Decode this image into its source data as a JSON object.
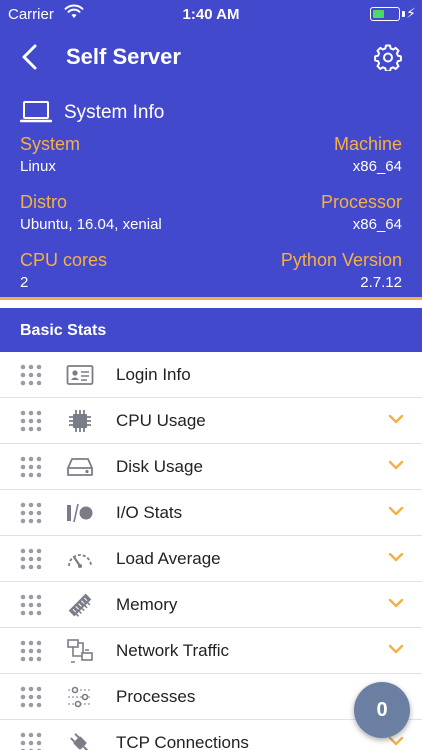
{
  "status_bar": {
    "carrier": "Carrier",
    "time": "1:40 AM",
    "battery_level": 0.45
  },
  "nav": {
    "title": "Self Server",
    "back_icon": "chevron-left-icon",
    "settings_icon": "gear-icon"
  },
  "system_info": {
    "title": "System Info",
    "icon": "laptop-icon",
    "rows": [
      {
        "left_label": "System",
        "left_value": "Linux",
        "right_label": "Machine",
        "right_value": "x86_64"
      },
      {
        "left_label": "Distro",
        "left_value": "Ubuntu, 16.04, xenial",
        "right_label": "Processor",
        "right_value": "x86_64"
      },
      {
        "left_label": "CPU cores",
        "left_value": "2",
        "right_label": "Python Version",
        "right_value": "2.7.12"
      }
    ]
  },
  "basic_stats": {
    "title": "Basic Stats",
    "items": [
      {
        "label": "Login Info",
        "icon": "id-card-icon",
        "expandable": false
      },
      {
        "label": "CPU Usage",
        "icon": "cpu-chip-icon",
        "expandable": true
      },
      {
        "label": "Disk Usage",
        "icon": "hard-drive-icon",
        "expandable": true
      },
      {
        "label": "I/O Stats",
        "icon": "io-icon",
        "expandable": true
      },
      {
        "label": "Load Average",
        "icon": "speedometer-icon",
        "expandable": true
      },
      {
        "label": "Memory",
        "icon": "memory-stick-icon",
        "expandable": true
      },
      {
        "label": "Network Traffic",
        "icon": "network-icon",
        "expandable": true
      },
      {
        "label": "Processes",
        "icon": "sliders-icon",
        "expandable": false
      },
      {
        "label": "TCP Connections",
        "icon": "plug-icon",
        "expandable": true
      }
    ]
  },
  "fab": {
    "count": "0"
  },
  "colors": {
    "primary": "#4249cc",
    "accent": "#f6b043",
    "fab": "#6b7fa3"
  }
}
